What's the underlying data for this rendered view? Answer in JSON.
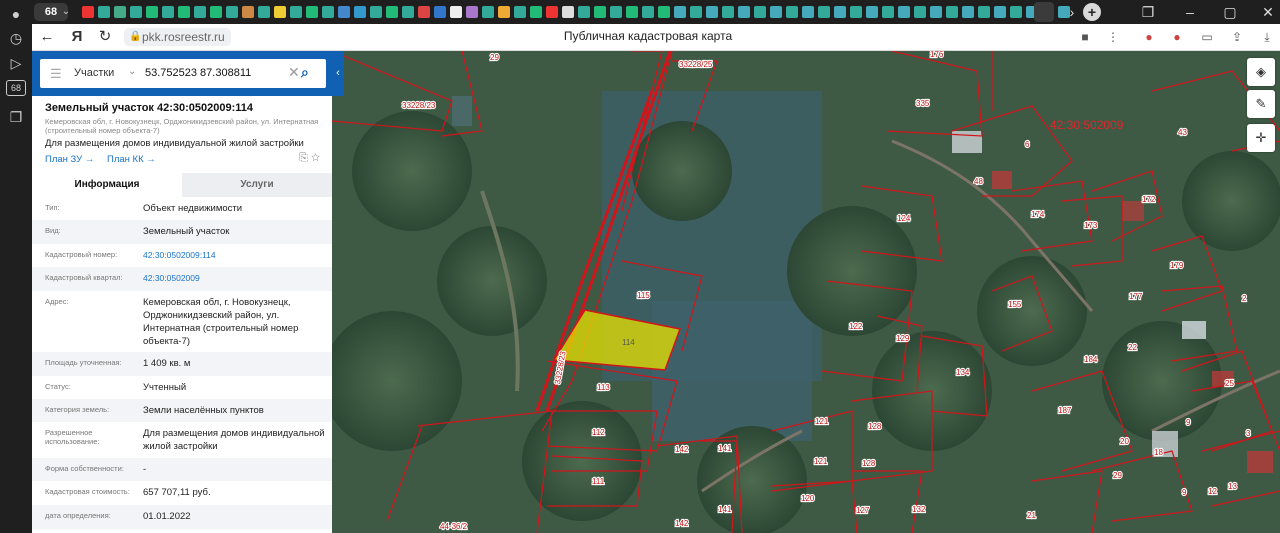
{
  "browser": {
    "tab_count": "68",
    "url": "pkk.rosreestr.ru",
    "page_title": "Публичная кадастровая карта"
  },
  "search": {
    "type": "Участки",
    "query": "53.752523 87.308811"
  },
  "parcel": {
    "title": "Земельный участок 42:30:0502009:114",
    "address_short": "Кемеровская обл, г. Новокузнецк, Орджоникидзевский район, ул. Интернатная (строительный номер объекта-7)",
    "use": "Для размещения домов индивидуальной жилой застройки",
    "link_plan_zu": "План ЗУ →",
    "link_plan_kk": "План КК →"
  },
  "tabs": {
    "info": "Информация",
    "services": "Услуги"
  },
  "rows": [
    {
      "label": "Тип:",
      "value": "Объект недвижимости"
    },
    {
      "label": "Вид:",
      "value": "Земельный участок"
    },
    {
      "label": "Кадастровый номер:",
      "value": "42:30:0502009:114"
    },
    {
      "label": "Кадастровый квартал:",
      "value": "42:30:0502009"
    },
    {
      "label": "Адрес:",
      "value": "Кемеровская обл, г. Новокузнецк, Орджоникидзевский район, ул. Интернатная (строительный номер объекта-7)"
    },
    {
      "label": "Площадь уточненная:",
      "value": "1 409 кв. м"
    },
    {
      "label": "Статус:",
      "value": "Учтенный"
    },
    {
      "label": "Категория земель:",
      "value": "Земли населённых пунктов"
    },
    {
      "label": "Разрешенное использование:",
      "value": "Для размещения домов индивидуальной жилой застройки"
    },
    {
      "label": "Форма собственности:",
      "value": "-"
    },
    {
      "label": "Кадастровая стоимость:",
      "value": "657 707,11 руб."
    },
    {
      "label": "дата определения:",
      "value": "01.01.2022"
    }
  ],
  "map": {
    "quarter_label": "42:30:502009",
    "selected_label": "114",
    "labels": [
      "29",
      "33228/25",
      "176",
      "335",
      "33228/23",
      "6",
      "43",
      "48",
      "172",
      "124",
      "174",
      "173",
      "179",
      "115",
      "155",
      "177",
      "2",
      "122",
      "129",
      "134",
      "22",
      "25",
      "184",
      "33228/23",
      "113",
      "187",
      "9",
      "3",
      "112",
      "121",
      "128",
      "142",
      "141",
      "20",
      "18",
      "121",
      "128",
      "111",
      "29",
      "9",
      "12",
      "13",
      "120",
      "127",
      "132",
      "141",
      "142",
      "21",
      "44-36/2"
    ]
  },
  "colors": {
    "accent": "#1060b3",
    "boundary": "#d2151b",
    "selected": "#e8e100"
  }
}
